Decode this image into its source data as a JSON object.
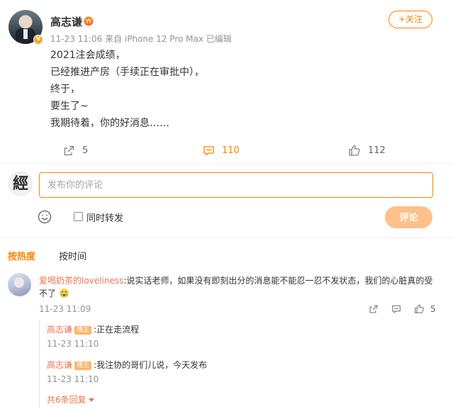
{
  "post": {
    "author": "高志谦",
    "follow_label": "+关注",
    "meta": "11-23 11:06  来自 iPhone 12 Pro Max 已编辑",
    "lines": [
      "2021注会成绩，",
      "已经推进产房（手续正在审批中），",
      "终于，",
      "要生了~",
      "我期待着，你的好消息……"
    ],
    "repost_count": "5",
    "comment_count": "110",
    "like_count": "112"
  },
  "composer": {
    "avatar_char": "經",
    "placeholder": "发布你的评论",
    "repost_label": "同时转发",
    "submit_label": "评论"
  },
  "sort": {
    "hot": "按热度",
    "time": "按时间"
  },
  "comment": {
    "user": "爱喝奶茶的loveliness",
    "text": ":说实话老师，如果没有即刻出分的消息能不能忍一忍不发状态，我们的心脏真的受不了",
    "time": "11-23 11:09",
    "like_count": "5"
  },
  "replies": [
    {
      "user": "高志谦",
      "badge": "博主",
      "text": ":正在走流程",
      "time": "11-23 11:10"
    },
    {
      "user": "高志谦",
      "badge": "博主",
      "text": ":我注协的哥们儿说，今天发布",
      "time": "11-23 11:10"
    }
  ],
  "more_replies": "共6条回复",
  "colors": {
    "accent": "#ff8200",
    "username": "#eb7350",
    "muted": "#939393"
  }
}
